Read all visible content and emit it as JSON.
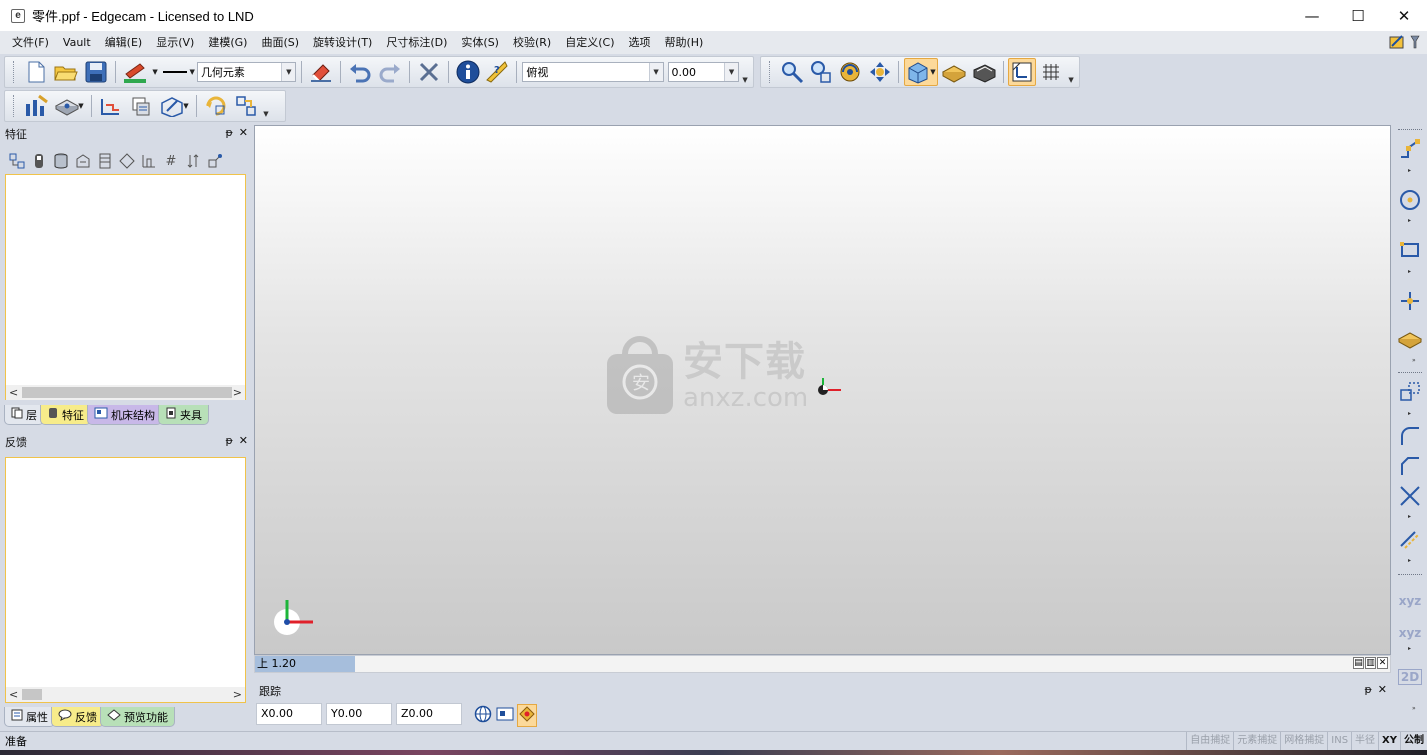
{
  "window": {
    "title": "零件.ppf - Edgecam - Licensed to LND",
    "icon_letter": "e",
    "minimize": "—",
    "maximize": "☐",
    "close": "✕"
  },
  "menu": [
    "文件(F)",
    "Vault",
    "编辑(E)",
    "显示(V)",
    "建模(G)",
    "曲面(S)",
    "旋转设计(T)",
    "尺寸标注(D)",
    "实体(S)",
    "校验(R)",
    "自定义(C)",
    "选项",
    "帮助(H)"
  ],
  "toolbar": {
    "entity_combo": "几何元素",
    "view_combo": "俯视",
    "depth_value": "0.00"
  },
  "panels": {
    "features": {
      "title": "特征",
      "pin": "ᵽ",
      "close": "✕",
      "tabs": [
        "层",
        "特征",
        "机床结构",
        "夹具"
      ]
    },
    "feedback": {
      "title": "反馈",
      "pin": "ᵽ",
      "close": "✕",
      "tabs": [
        "属性",
        "反馈",
        "预览功能"
      ]
    }
  },
  "viewport": {
    "status_left": "上 1.20",
    "watermark_cn": "安下载",
    "watermark_en": "anxz.com"
  },
  "tracking": {
    "title": "跟踪",
    "x": "X0.00",
    "y": "Y0.00",
    "z": "Z0.00"
  },
  "right_toolbar": {
    "xyz1": "xyz",
    "xyz2": "xyz",
    "label_2d": "2D"
  },
  "status": {
    "left": "准备",
    "cells": [
      "自由捕捉",
      "元素捕捉",
      "网格捕捉",
      "INS",
      "半径",
      "XY",
      "公制"
    ],
    "active": [
      "XY",
      "公制"
    ]
  },
  "colors": {
    "panel_bg": "#d6dbe5",
    "accent_orange": "#fcd99a",
    "tab_features": "#f7ec8a",
    "tab_machine": "#c8b8e8",
    "tab_fixture": "#b8e0b8",
    "tab_properties": "#f7ec8a",
    "tab_feedback": "#f7ec8a",
    "tab_preview": "#b8e0b8"
  }
}
